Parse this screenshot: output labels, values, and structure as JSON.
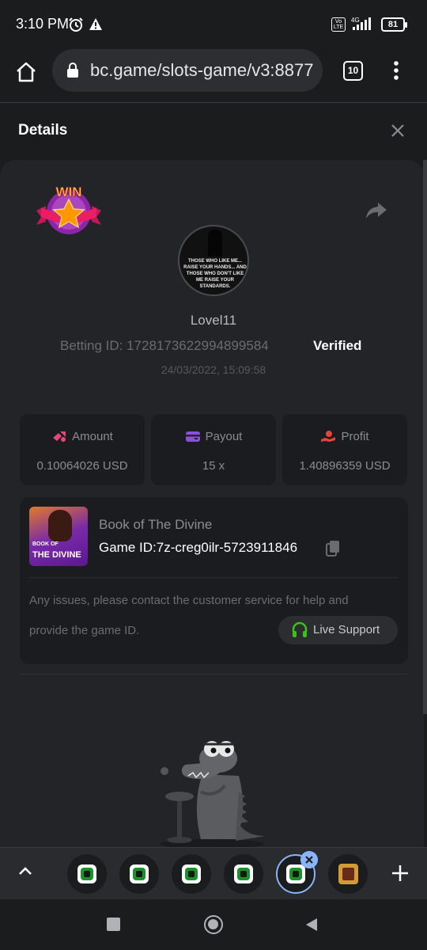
{
  "status_bar": {
    "time": "3:10 PM",
    "volte": "Vo LTE",
    "network": "4G",
    "battery": "81",
    "icons": [
      "alarm-icon",
      "warning-icon",
      "signal-icon",
      "battery-icon"
    ]
  },
  "browser": {
    "url": "bc.game/slots-game/v3:8877",
    "tab_count": "10",
    "icons": [
      "home-icon",
      "lock-icon",
      "more-vert-icon"
    ]
  },
  "details": {
    "title": "Details",
    "username": "Lovel11",
    "betting_id": "Betting ID: 1728173622994899584",
    "verified": "Verified",
    "timestamp": "24/03/2022, 15:09:58",
    "badge": "WIN",
    "avatar_caption": "THOSE WHO LIKE ME... RAISE YOUR HANDS... AND THOSE WHO DON'T LIKE ME RAISE YOUR STANDARDS."
  },
  "stats": {
    "amount": {
      "label": "Amount",
      "value": "0.10064026 USD",
      "color": "#e8457a"
    },
    "payout": {
      "label": "Payout",
      "value": "15 x",
      "color": "#8b4fe0"
    },
    "profit": {
      "label": "Profit",
      "value": "1.40896359 USD",
      "color": "#e8453a"
    }
  },
  "game": {
    "name": "Book of The Divine",
    "id": "Game ID:7z-creg0ilr-5723911846",
    "thumb_line1": "BOOK OF",
    "thumb_line2": "THE DIVINE",
    "issue_line1": "Any issues, please contact the customer service for help and",
    "issue_line2": "provide the game ID.",
    "support_label": "Live Support",
    "support_color": "#3bc117"
  },
  "tab_strip": {
    "tabs": [
      "bc-game-tab",
      "bc-game-tab",
      "bc-game-tab",
      "bc-game-tab",
      "bc-game-tab-active",
      "book-of-divine-tab"
    ],
    "accent": "#8ab4f8"
  }
}
